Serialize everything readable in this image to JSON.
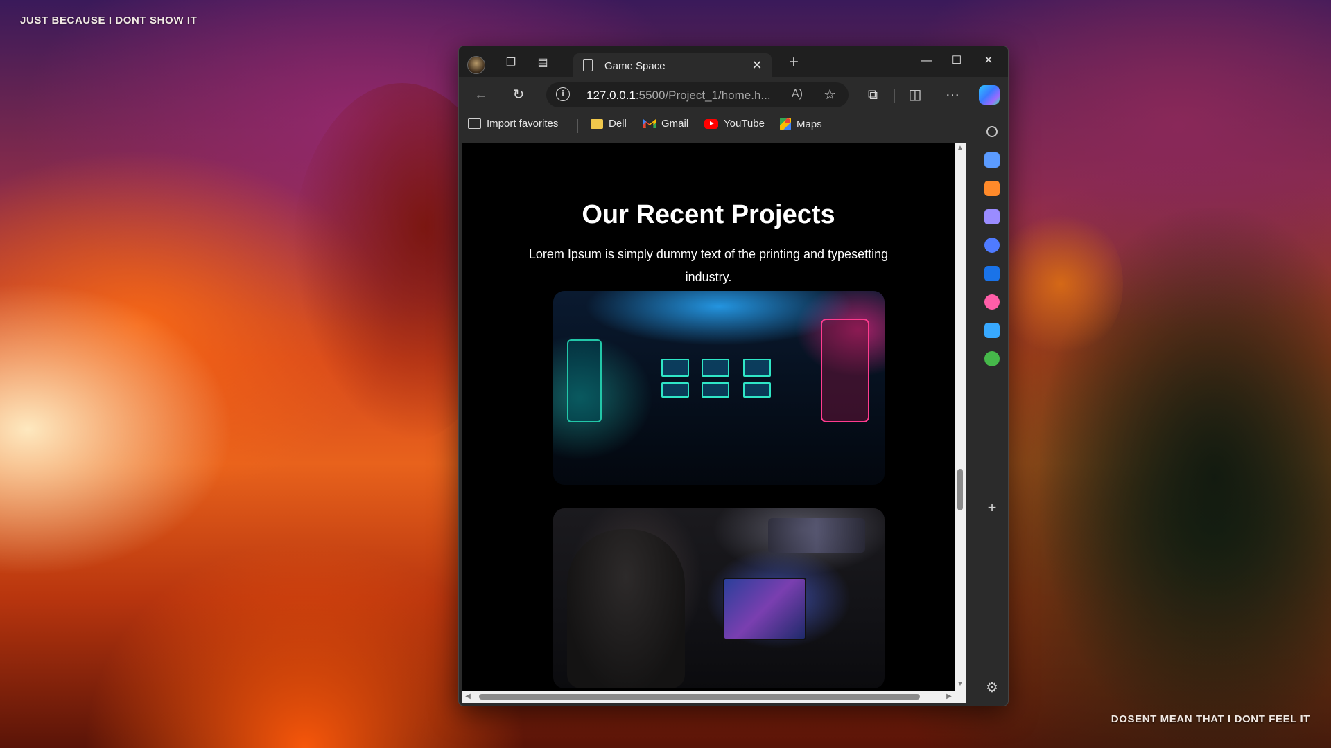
{
  "desktop": {
    "top_text": "JUST BECAUSE I DONT SHOW IT",
    "bottom_text": "DOSENT MEAN THAT I DONT FEEL IT"
  },
  "browser": {
    "tab": {
      "title": "Game Space",
      "close_glyph": "✕"
    },
    "new_tab_glyph": "+",
    "window_controls": {
      "minimize": "—",
      "maximize": "☐",
      "close": "✕"
    },
    "toolbar": {
      "back_glyph": "←",
      "refresh_glyph": "↻",
      "url_host": "127.0.0.1",
      "url_rest": ":5500/Project_1/home.h...",
      "info_glyph": "i",
      "read_aloud_glyph": "A)",
      "favorite_glyph": "☆",
      "extensions_glyph": "⧉",
      "split_glyph": "◫",
      "more_glyph": "···"
    },
    "favorites": [
      {
        "label": "Import favorites",
        "icon": "import-icon"
      },
      {
        "label": "Dell",
        "icon": "folder-icon"
      },
      {
        "label": "Gmail",
        "icon": "gmail-icon"
      },
      {
        "label": "YouTube",
        "icon": "youtube-icon"
      },
      {
        "label": "Maps",
        "icon": "maps-icon"
      }
    ],
    "sidebar": {
      "icons": [
        "search-icon",
        "shopping-tag-icon",
        "tools-briefcase-icon",
        "games-icon",
        "copilot-icon",
        "outlook-icon",
        "designer-icon",
        "send-icon",
        "tree-icon"
      ],
      "add_glyph": "+",
      "settings_glyph": "⚙",
      "colors": [
        "#c8c8c8",
        "#5b9bff",
        "#ff8a2a",
        "#9a8cff",
        "#4f7bff",
        "#1a73e8",
        "#ff5ea8",
        "#38a9ff",
        "#46b84a"
      ]
    }
  },
  "page": {
    "title": "Our Recent Projects",
    "subtitle": "Lorem Ipsum is simply dummy text of the printing and typesetting industry.",
    "cards": [
      {
        "name": "arcade-room-image"
      },
      {
        "name": "gamer-at-pc-image"
      }
    ]
  }
}
